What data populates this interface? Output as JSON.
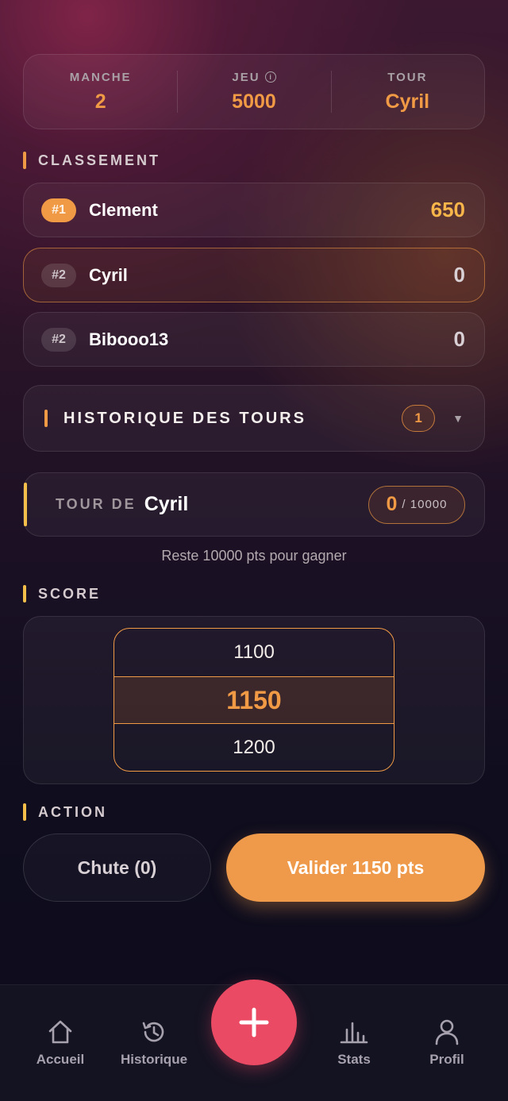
{
  "stats": {
    "manche_label": "MANCHE",
    "manche_value": "2",
    "jeu_label": "JEU",
    "jeu_value": "5000",
    "tour_label": "TOUR",
    "tour_value": "Cyril"
  },
  "ranking": {
    "title": "CLASSEMENT",
    "players": [
      {
        "rank": "#1",
        "name": "Clement",
        "score": "650"
      },
      {
        "rank": "#2",
        "name": "Cyril",
        "score": "0"
      },
      {
        "rank": "#2",
        "name": "Bibooo13",
        "score": "0"
      }
    ]
  },
  "history": {
    "title": "HISTORIQUE DES TOURS",
    "count": "1"
  },
  "turn": {
    "label": "TOUR DE",
    "player": "Cyril",
    "current": "0",
    "target": "/ 10000",
    "remaining": "Reste 10000 pts pour gagner"
  },
  "score": {
    "title": "SCORE",
    "options": [
      "1100",
      "1150",
      "1200"
    ]
  },
  "action": {
    "title": "ACTION",
    "chute_label": "Chute (0)",
    "validate_label": "Valider 1150 pts"
  },
  "nav": {
    "home": "Accueil",
    "history": "Historique",
    "stats": "Stats",
    "profile": "Profil"
  },
  "colors": {
    "accent": "#f19a45",
    "fab": "#ea4a63"
  }
}
